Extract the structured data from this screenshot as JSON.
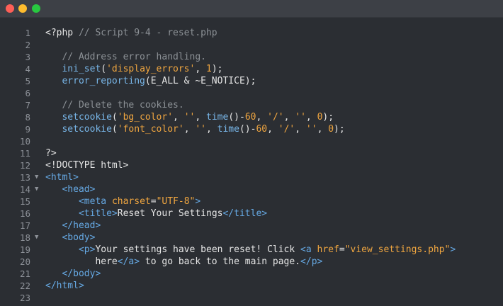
{
  "window": {
    "buttons": [
      "close",
      "minimize",
      "maximize"
    ]
  },
  "code": {
    "lines": [
      {
        "n": "1",
        "fold": false,
        "html": "&lt;?php <span class=\"comment\">// Script 9-4 - reset.php</span>"
      },
      {
        "n": "2",
        "fold": false,
        "html": ""
      },
      {
        "n": "3",
        "fold": false,
        "html": "   <span class=\"comment\">// Address error handling.</span>"
      },
      {
        "n": "4",
        "fold": false,
        "html": "   <span class=\"fn\">ini_set</span>(<span class=\"str\">'display_errors'</span>, <span class=\"num\">1</span>);"
      },
      {
        "n": "5",
        "fold": false,
        "html": "   <span class=\"fn\">error_reporting</span>(E_ALL &amp; ~E_NOTICE);"
      },
      {
        "n": "6",
        "fold": false,
        "html": ""
      },
      {
        "n": "7",
        "fold": false,
        "html": "   <span class=\"comment\">// Delete the cookies.</span>"
      },
      {
        "n": "8",
        "fold": false,
        "html": "   <span class=\"fn\">setcookie</span>(<span class=\"str\">'bg_color'</span>, <span class=\"str\">''</span>, <span class=\"fn\">time</span>()-<span class=\"num\">60</span>, <span class=\"str\">'/'</span>, <span class=\"str\">''</span>, <span class=\"num\">0</span>);"
      },
      {
        "n": "9",
        "fold": false,
        "html": "   <span class=\"fn\">setcookie</span>(<span class=\"str\">'font_color'</span>, <span class=\"str\">''</span>, <span class=\"fn\">time</span>()-<span class=\"num\">60</span>, <span class=\"str\">'/'</span>, <span class=\"str\">''</span>, <span class=\"num\">0</span>);"
      },
      {
        "n": "10",
        "fold": false,
        "html": ""
      },
      {
        "n": "11",
        "fold": false,
        "html": "?&gt;"
      },
      {
        "n": "12",
        "fold": false,
        "html": "&lt;!DOCTYPE html&gt;"
      },
      {
        "n": "13",
        "fold": true,
        "html": "<span class=\"tag\">&lt;html&gt;</span>"
      },
      {
        "n": "14",
        "fold": true,
        "html": "   <span class=\"tag\">&lt;head&gt;</span>"
      },
      {
        "n": "15",
        "fold": false,
        "html": "      <span class=\"tag\">&lt;meta</span> <span class=\"attr\">charset</span>=<span class=\"str\">\"UTF-8\"</span><span class=\"tag\">&gt;</span>"
      },
      {
        "n": "16",
        "fold": false,
        "html": "      <span class=\"tag\">&lt;title&gt;</span>Reset Your Settings<span class=\"tag\">&lt;/title&gt;</span>"
      },
      {
        "n": "17",
        "fold": false,
        "html": "   <span class=\"tag\">&lt;/head&gt;</span>"
      },
      {
        "n": "18",
        "fold": true,
        "html": "   <span class=\"tag\">&lt;body&gt;</span>"
      },
      {
        "n": "19",
        "fold": false,
        "html": "      <span class=\"tag\">&lt;p&gt;</span>Your settings have been reset! Click <span class=\"tag\">&lt;a</span> <span class=\"attr\">href</span>=<span class=\"str\">\"view_settings.php\"</span><span class=\"tag\">&gt;</span>"
      },
      {
        "n": "20",
        "fold": false,
        "html": "         here<span class=\"tag\">&lt;/a&gt;</span> to go back to the main page.<span class=\"tag\">&lt;/p&gt;</span>"
      },
      {
        "n": "21",
        "fold": false,
        "html": "   <span class=\"tag\">&lt;/body&gt;</span>"
      },
      {
        "n": "22",
        "fold": false,
        "html": "<span class=\"tag\">&lt;/html&gt;</span>"
      },
      {
        "n": "23",
        "fold": false,
        "html": ""
      }
    ]
  }
}
